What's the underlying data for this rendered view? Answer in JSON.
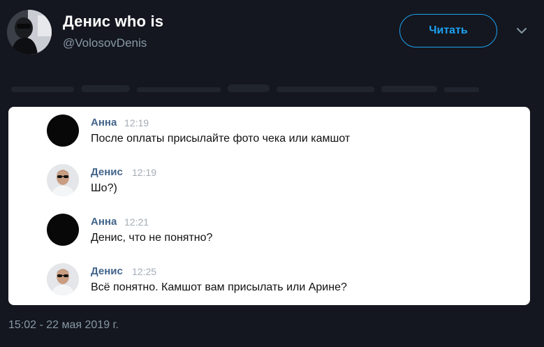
{
  "tweet": {
    "author_name": "Денис who is",
    "author_handle": "@VolosovDenis",
    "follow_label": "Читать",
    "timestamp": "15:02 - 22 мая 2019 г."
  },
  "messages": [
    {
      "sender": "Анна",
      "time": "12:19",
      "text": "После оплаты присылайте фото чека или камшот",
      "avatar": "dark-avatar"
    },
    {
      "sender": "Денис",
      "time": "12:19",
      "text": "Шо?)",
      "avatar": "man-sunglasses-avatar"
    },
    {
      "sender": "Анна",
      "time": "12:21",
      "text": "Денис, что не понятно?",
      "avatar": "dark-avatar"
    },
    {
      "sender": "Денис",
      "time": "12:25",
      "text": "Всё понятно. Камшот вам присылать или Арине?",
      "avatar": "man-sunglasses-avatar"
    }
  ],
  "colors": {
    "background": "#14171f",
    "accent": "#1da1f2",
    "sender_name": "#42648b",
    "muted": "#8899a6"
  }
}
